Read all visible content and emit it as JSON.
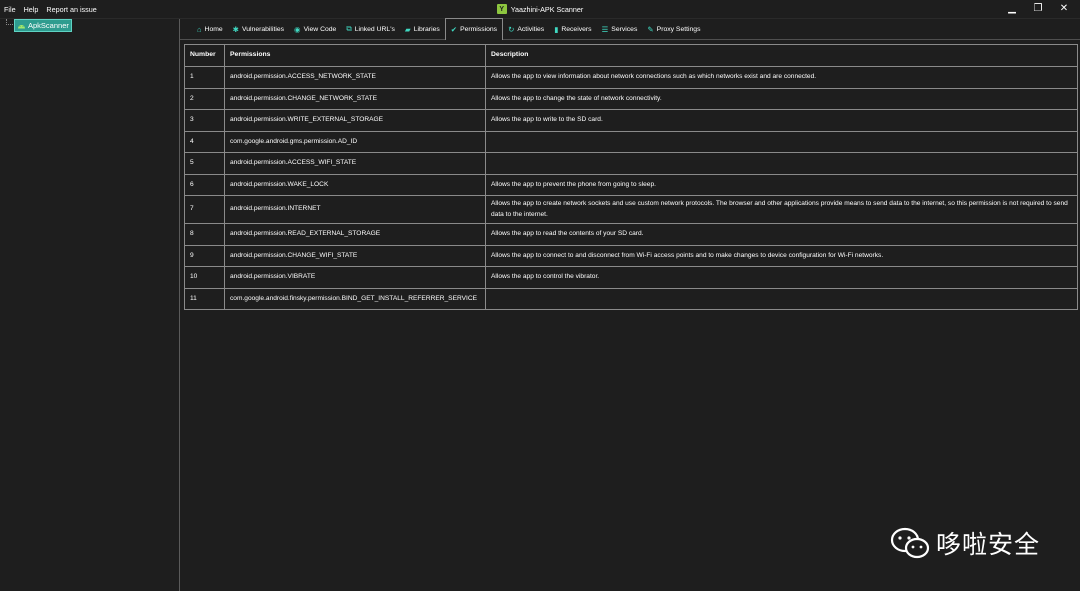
{
  "menu": {
    "file": "File",
    "help": "Help",
    "report": "Report an issue"
  },
  "window": {
    "logo_letter": "Y",
    "title": "Yaazhini-APK Scanner",
    "minimize": "▁",
    "restore": "❐",
    "close": "✕"
  },
  "sidebar": {
    "root_label": "ApkScanner"
  },
  "tabs": [
    {
      "label": "Home",
      "icon": "home-icon",
      "glyph": "⌂"
    },
    {
      "label": "Vulnerabilities",
      "icon": "bug-icon",
      "glyph": "✱"
    },
    {
      "label": "View Code",
      "icon": "eye-icon",
      "glyph": "◉"
    },
    {
      "label": "Linked URL's",
      "icon": "external-link-icon",
      "glyph": "⧉"
    },
    {
      "label": "Libraries",
      "icon": "folder-icon",
      "glyph": "▰"
    },
    {
      "label": "Permissions",
      "icon": "check-icon",
      "glyph": "✔"
    },
    {
      "label": "Activities",
      "icon": "refresh-icon",
      "glyph": "↻"
    },
    {
      "label": "Receivers",
      "icon": "signal-icon",
      "glyph": "▮"
    },
    {
      "label": "Services",
      "icon": "list-icon",
      "glyph": "☰"
    },
    {
      "label": "Proxy Settings",
      "icon": "wrench-icon",
      "glyph": "✎"
    }
  ],
  "active_tab": "Permissions",
  "table": {
    "headers": [
      "Number",
      "Permissions",
      "Description"
    ],
    "rows": [
      [
        "1",
        "android.permission.ACCESS_NETWORK_STATE",
        "Allows the app to view information about network connections such as which networks exist and are connected."
      ],
      [
        "2",
        "android.permission.CHANGE_NETWORK_STATE",
        "Allows the app to change the state of network connectivity."
      ],
      [
        "3",
        "android.permission.WRITE_EXTERNAL_STORAGE",
        "Allows the app to write to the SD card."
      ],
      [
        "4",
        "com.google.android.gms.permission.AD_ID",
        ""
      ],
      [
        "5",
        "android.permission.ACCESS_WIFI_STATE",
        ""
      ],
      [
        "6",
        "android.permission.WAKE_LOCK",
        "Allows the app to prevent the phone from going to sleep."
      ],
      [
        "7",
        "android.permission.INTERNET",
        "Allows the app to create network sockets and use custom network protocols. The browser and other applications provide means to send data to the internet, so this permission is not required to send data to the internet."
      ],
      [
        "8",
        "android.permission.READ_EXTERNAL_STORAGE",
        "Allows the app to read the contents of your SD card."
      ],
      [
        "9",
        "android.permission.CHANGE_WIFI_STATE",
        "Allows the app to connect to and disconnect from Wi-Fi access points and to make changes to device configuration for Wi-Fi networks."
      ],
      [
        "10",
        "android.permission.VIBRATE",
        "Allows the app to control the vibrator."
      ],
      [
        "11",
        "com.google.android.finsky.permission.BIND_GET_INSTALL_REFERRER_SERVICE",
        ""
      ]
    ]
  },
  "watermark": {
    "text": "哆啦安全"
  },
  "colors": {
    "accent": "#3fd9c2",
    "background": "#1e1e1e",
    "border": "#8a8a8a",
    "tree_selected": "#2e9c8f"
  }
}
